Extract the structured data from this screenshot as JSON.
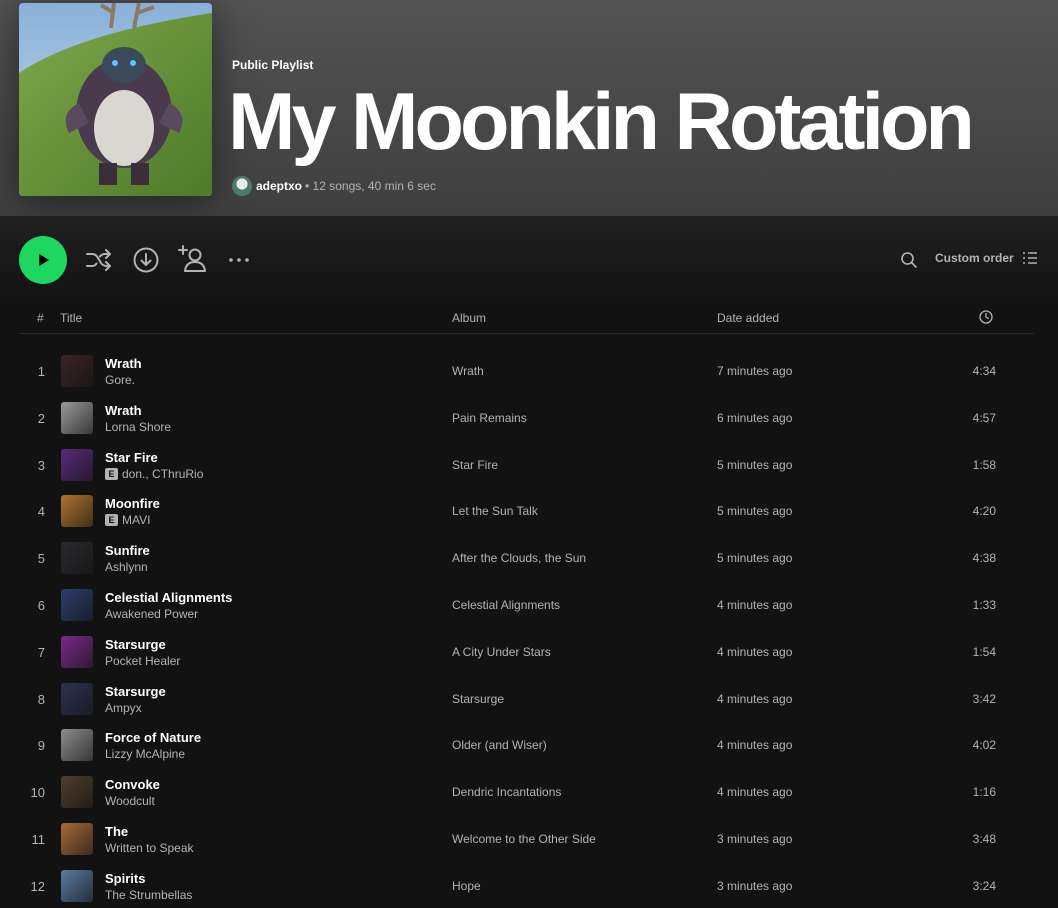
{
  "playlist": {
    "type_label": "Public Playlist",
    "title": "My Moonkin Rotation",
    "owner": "adeptxo",
    "meta": "• 12 songs, 40 min 6 sec"
  },
  "controls": {
    "sort_label": "Custom order"
  },
  "table": {
    "col_num": "#",
    "col_title": "Title",
    "col_album": "Album",
    "col_date": "Date added"
  },
  "colors": {
    "accent": "#1ed760",
    "background": "#121212",
    "header_bg": "#535353"
  },
  "tracks": [
    {
      "num": "1",
      "title": "Wrath",
      "artist": "Gore.",
      "explicit": false,
      "album": "Wrath",
      "date": "7 minutes ago",
      "duration": "4:34",
      "thumb": "#3a2424"
    },
    {
      "num": "2",
      "title": "Wrath",
      "artist": "Lorna Shore",
      "explicit": false,
      "album": "Pain Remains",
      "date": "6 minutes ago",
      "duration": "4:57",
      "thumb": "#9a9a9a"
    },
    {
      "num": "3",
      "title": "Star Fire",
      "artist": "don., CThruRio",
      "explicit": true,
      "album": "Star Fire",
      "date": "5 minutes ago",
      "duration": "1:58",
      "thumb": "#5a2a7a"
    },
    {
      "num": "4",
      "title": "Moonfire",
      "artist": "MAVI",
      "explicit": true,
      "album": "Let the Sun Talk",
      "date": "5 minutes ago",
      "duration": "4:20",
      "thumb": "#b0742e"
    },
    {
      "num": "5",
      "title": "Sunfire",
      "artist": "Ashlynn",
      "explicit": false,
      "album": "After the Clouds, the Sun",
      "date": "5 minutes ago",
      "duration": "4:38",
      "thumb": "#2a2a2e"
    },
    {
      "num": "6",
      "title": "Celestial Alignments",
      "artist": "Awakened Power",
      "explicit": false,
      "album": "Celestial Alignments",
      "date": "4 minutes ago",
      "duration": "1:33",
      "thumb": "#2c3e6a"
    },
    {
      "num": "7",
      "title": "Starsurge",
      "artist": "Pocket Healer",
      "explicit": false,
      "album": "A City Under Stars",
      "date": "4 minutes ago",
      "duration": "1:54",
      "thumb": "#7a2a8a"
    },
    {
      "num": "8",
      "title": "Starsurge",
      "artist": "Ampyx",
      "explicit": false,
      "album": "Starsurge",
      "date": "4 minutes ago",
      "duration": "3:42",
      "thumb": "#2e3450"
    },
    {
      "num": "9",
      "title": "Force of Nature",
      "artist": "Lizzy McAlpine",
      "explicit": false,
      "album": "Older (and Wiser)",
      "date": "4 minutes ago",
      "duration": "4:02",
      "thumb": "#8e8e8e"
    },
    {
      "num": "10",
      "title": "Convoke",
      "artist": "Woodcult",
      "explicit": false,
      "album": "Dendric Incantations",
      "date": "4 minutes ago",
      "duration": "1:16",
      "thumb": "#4e3e2e"
    },
    {
      "num": "11",
      "title": "The",
      "artist": "Written to Speak",
      "explicit": false,
      "album": "Welcome to the Other Side",
      "date": "3 minutes ago",
      "duration": "3:48",
      "thumb": "#a86a3a"
    },
    {
      "num": "12",
      "title": "Spirits",
      "artist": "The Strumbellas",
      "explicit": false,
      "album": "Hope",
      "date": "3 minutes ago",
      "duration": "3:24",
      "thumb": "#5a7aa0"
    }
  ]
}
